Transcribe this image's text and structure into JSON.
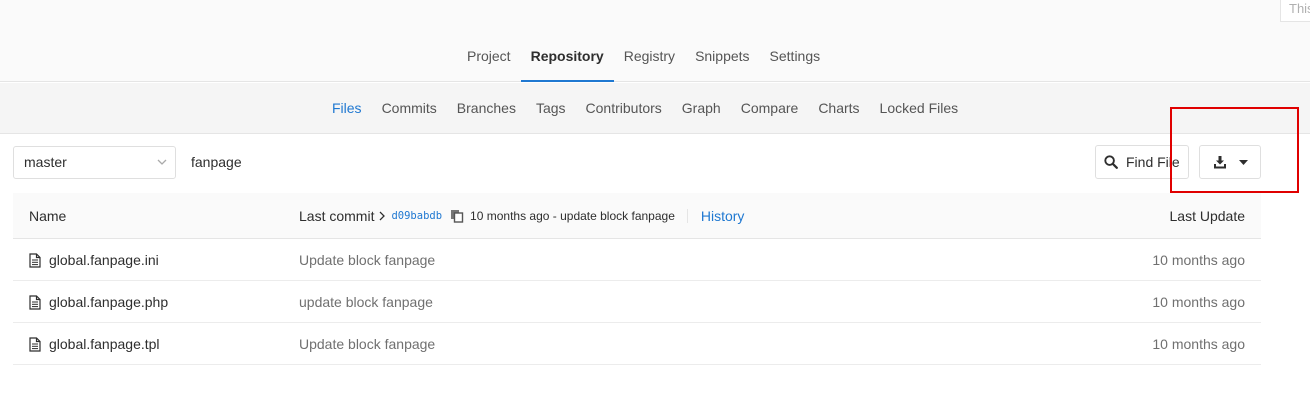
{
  "corner_hint": "This",
  "main_nav": {
    "items": [
      {
        "label": "Project"
      },
      {
        "label": "Repository"
      },
      {
        "label": "Registry"
      },
      {
        "label": "Snippets"
      },
      {
        "label": "Settings"
      }
    ],
    "active": "Repository"
  },
  "sub_nav": {
    "items": [
      {
        "label": "Files"
      },
      {
        "label": "Commits"
      },
      {
        "label": "Branches"
      },
      {
        "label": "Tags"
      },
      {
        "label": "Contributors"
      },
      {
        "label": "Graph"
      },
      {
        "label": "Compare"
      },
      {
        "label": "Charts"
      },
      {
        "label": "Locked Files"
      }
    ],
    "active": "Files"
  },
  "tree_controls": {
    "branch": "master",
    "path": "fanpage",
    "find_file_label": "Find File",
    "download_icon": "download-icon",
    "dropdown_icon": "caret-down-icon"
  },
  "table": {
    "headers": {
      "name": "Name",
      "last_commit": "Last commit",
      "last_update": "Last Update"
    },
    "last_commit": {
      "sha": "d09babdb",
      "message": "10 months ago - update block fanpage",
      "history_label": "History"
    },
    "rows": [
      {
        "name": "global.fanpage.ini",
        "message": "Update block fanpage",
        "time": "10 months ago"
      },
      {
        "name": "global.fanpage.php",
        "message": "update block fanpage",
        "time": "10 months ago"
      },
      {
        "name": "global.fanpage.tpl",
        "message": "Update block fanpage",
        "time": "10 months ago"
      }
    ]
  },
  "colors": {
    "accent": "#1f78d1",
    "highlight": "#e00000"
  }
}
